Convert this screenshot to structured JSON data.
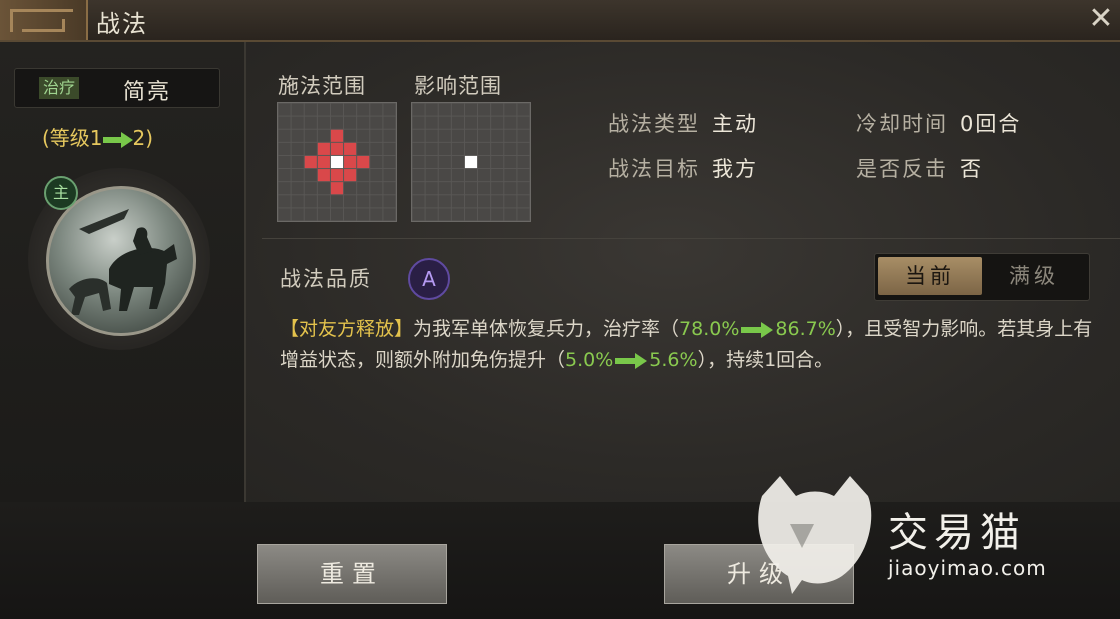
{
  "header": {
    "title": "战法",
    "close_icon": "close-icon"
  },
  "skill": {
    "tag": "治疗",
    "name": "简亮",
    "level_prefix": "(等级1",
    "level_suffix": "2)",
    "main_badge": "主"
  },
  "ranges": {
    "cast_label": "施法范围",
    "effect_label": "影响范围"
  },
  "info": {
    "type_label": "战法类型",
    "type_value": "主动",
    "cooldown_label": "冷却时间",
    "cooldown_value": "0回合",
    "target_label": "战法目标",
    "target_value": "我方",
    "counter_label": "是否反击",
    "counter_value": "否"
  },
  "quality": {
    "label": "战法品质",
    "grade": "A"
  },
  "toggle": {
    "current": "当前",
    "max": "满级"
  },
  "description": {
    "lead": "【对友方释放】",
    "t1": "为我军单体恢复兵力，治疗率（",
    "n1a": "78.0%",
    "n1b": "86.7%",
    "t2": "），且受智力影响。若其身上有增益状态，则额外附加免伤提升（",
    "n2a": "5.0%",
    "n2b": "5.6%",
    "t3": "），持续1回合。"
  },
  "buttons": {
    "reset": "重置",
    "upgrade": "升级"
  },
  "watermark": {
    "brand": "交易猫",
    "url": "jiaoyimao.com"
  },
  "colors": {
    "highlight_green": "#89c94f",
    "lead_yellow": "#e3c24c",
    "range_red": "#d9484a"
  }
}
